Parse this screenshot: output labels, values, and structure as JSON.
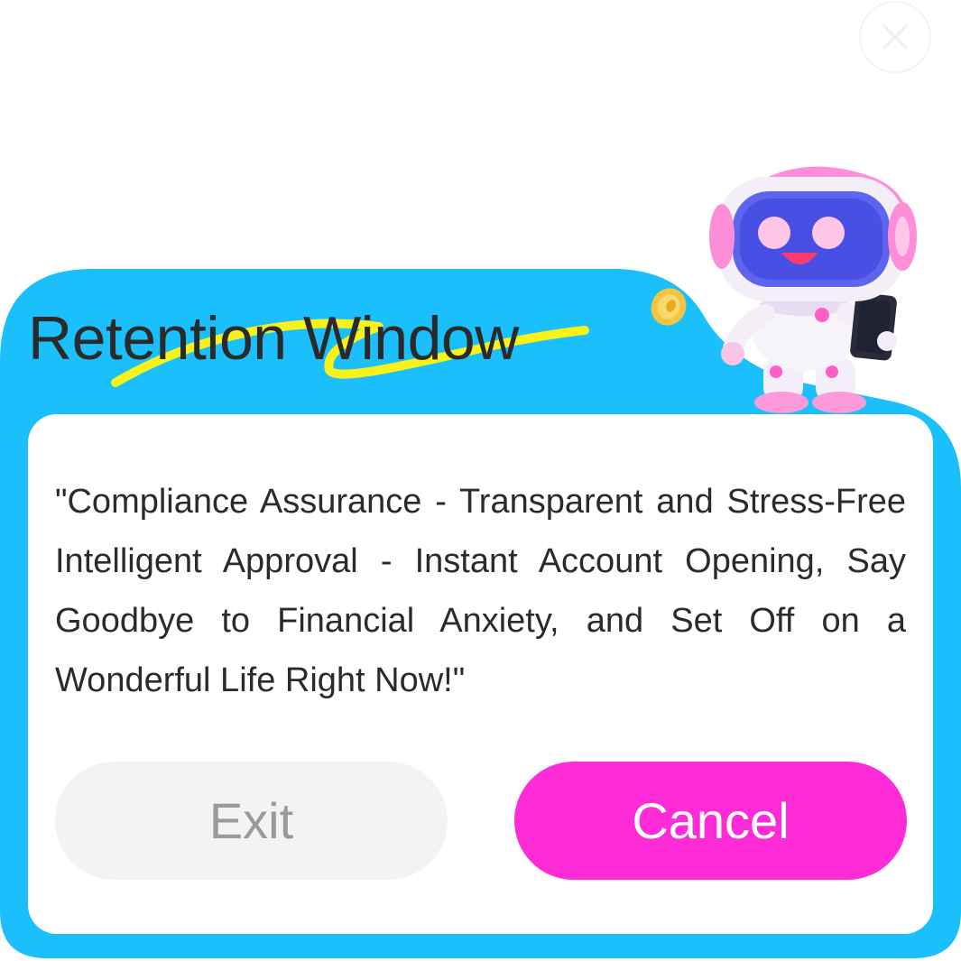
{
  "dialog": {
    "title": "Retention Window",
    "message": "\"Compliance Assurance - Transparent and Stress-Free Intelligent Approval - Instant Account Opening, Say Goodbye to Financial Anxiety, and Set Off on a Wonderful Life Right Now!\"",
    "exit_label": "Exit",
    "cancel_label": "Cancel"
  },
  "icons": {
    "close": "close-icon",
    "coin": "coin-icon",
    "mascot": "robot-mascot"
  },
  "colors": {
    "frame_blue": "#1bbffc",
    "highlight_yellow": "#f7f21a",
    "cancel_pink": "#ff2bd6",
    "exit_gray": "#f3f3f3"
  }
}
